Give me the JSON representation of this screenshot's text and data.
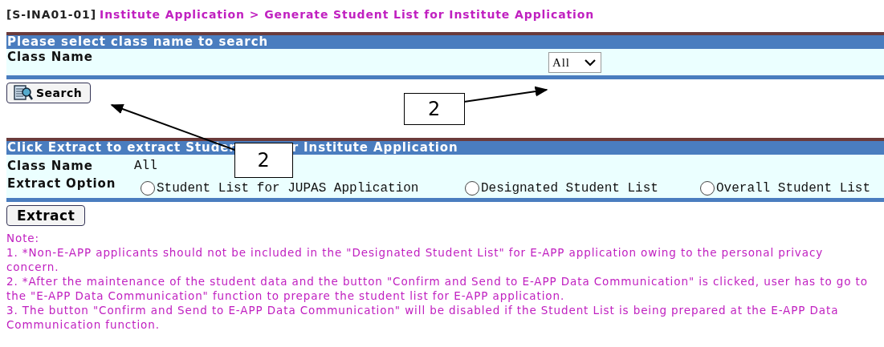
{
  "breadcrumb": {
    "code": "[S-INA01-01]",
    "path": "Institute Application > Generate Student List for Institute Application"
  },
  "search_section": {
    "title": "Please select class name to search",
    "field_label": "Class Name",
    "class_select": {
      "value": "All"
    },
    "button": "Search"
  },
  "extract_section": {
    "title_parts": [
      "Click Extract to extract Studer",
      "r Institute Application"
    ],
    "class_label": "Class Name",
    "class_value": "All",
    "option_label": "Extract Option",
    "options": [
      {
        "label": "Student List for JUPAS Application",
        "selected": false
      },
      {
        "label": "Designated Student List",
        "selected": false
      },
      {
        "label": "Overall Student List",
        "selected": false
      }
    ],
    "button": "Extract"
  },
  "notes": {
    "heading": "Note:",
    "items": [
      "1. *Non-E-APP applicants should not be included in the \"Designated Student List\" for E-APP application owing to the personal privacy concern.",
      "2. *After the maintenance of the student data and the button \"Confirm and Send to E-APP Data Communication\" is clicked, user has to go to the \"E-APP Data Communication\" function to prepare the student list for E-APP application.",
      "3. The button \"Confirm and Send to E-APP Data Communication\" will be disabled if the Student List is being prepared at the E-APP Data Communication function."
    ]
  },
  "callouts": [
    {
      "label": "2"
    },
    {
      "label": "2"
    }
  ]
}
